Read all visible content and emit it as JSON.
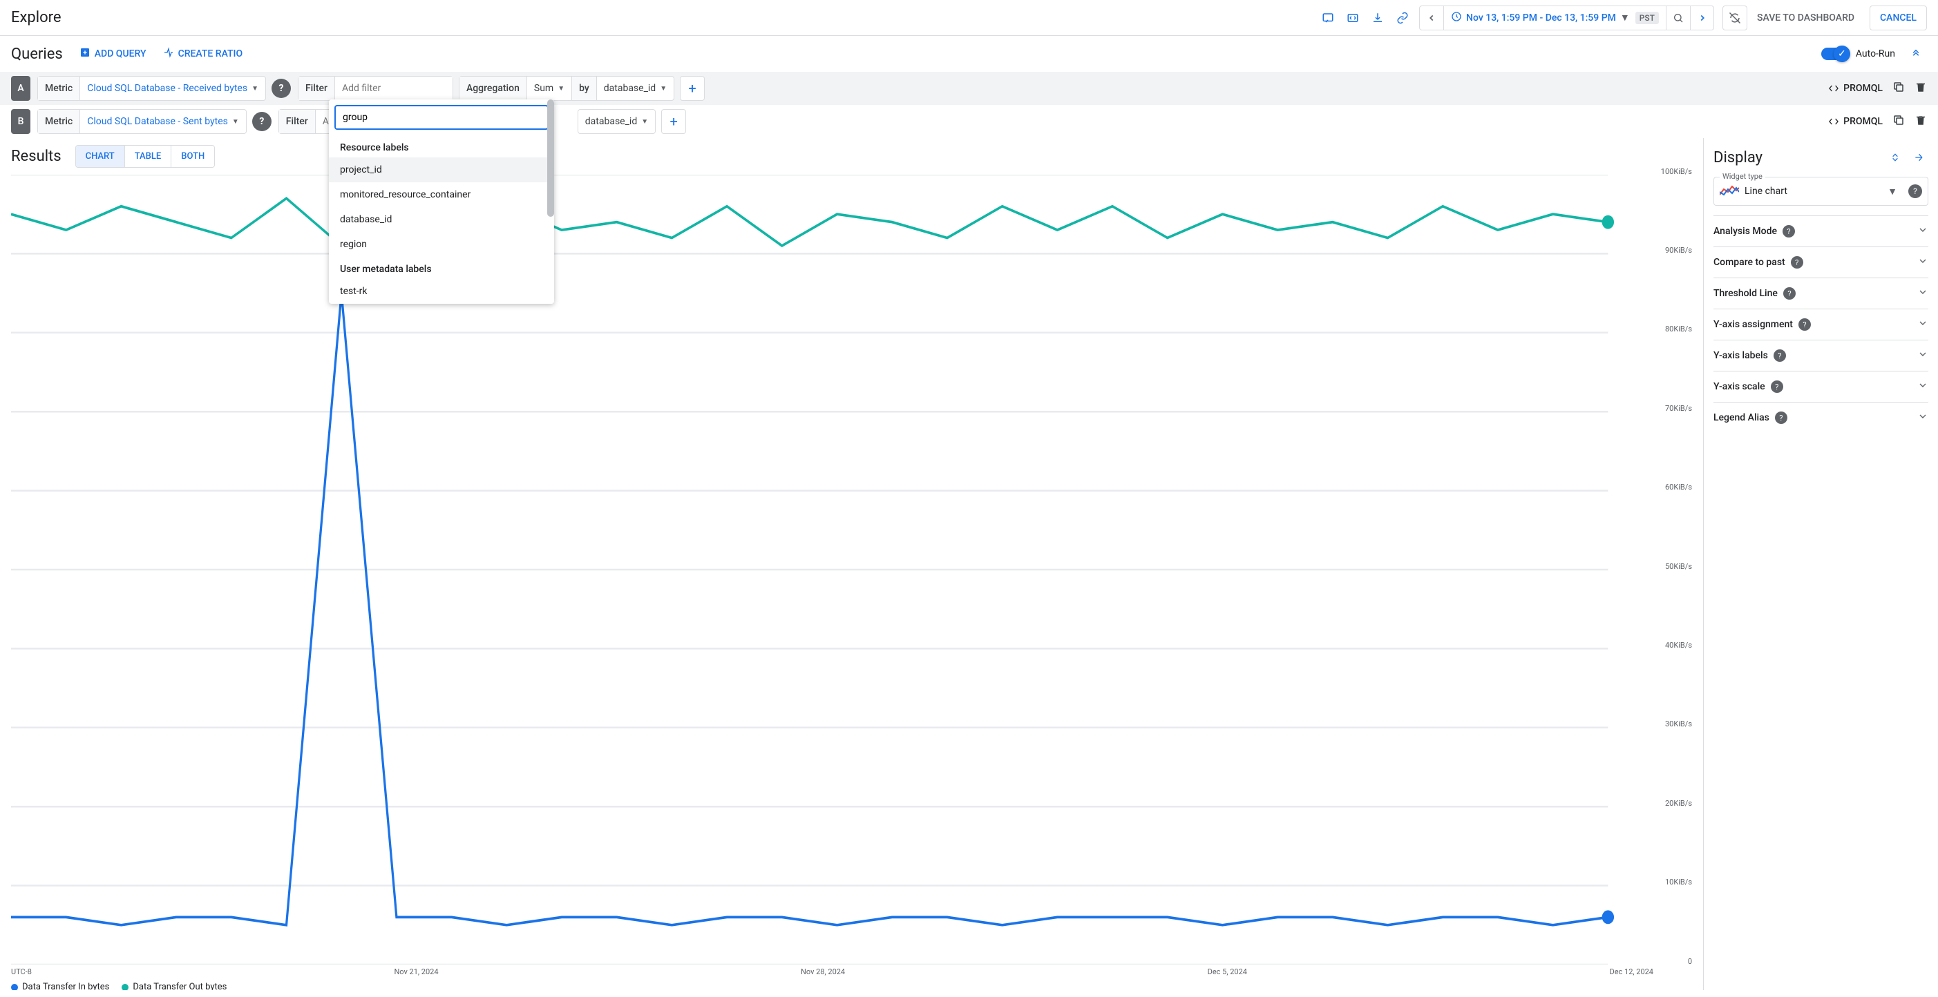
{
  "header": {
    "title": "Explore",
    "timerange": "Nov 13, 1:59 PM - Dec 13, 1:59 PM",
    "tz": "PST",
    "save": "SAVE TO DASHBOARD",
    "cancel": "CANCEL"
  },
  "queries": {
    "title": "Queries",
    "add": "ADD QUERY",
    "ratio": "CREATE RATIO",
    "autorun": "Auto-Run"
  },
  "rowA": {
    "badge": "A",
    "metric_lbl": "Metric",
    "metric_val": "Cloud SQL Database - Received bytes",
    "filter_lbl": "Filter",
    "filter_ph": "Add filter",
    "agg_lbl": "Aggregation",
    "agg_val": "Sum",
    "by": "by",
    "by_val": "database_id",
    "promql": "PROMQL"
  },
  "rowB": {
    "badge": "B",
    "metric_lbl": "Metric",
    "metric_val": "Cloud SQL Database - Sent bytes",
    "filter_lbl": "Filter",
    "filter_ph": "Add",
    "by_val": "database_id",
    "promql": "PROMQL"
  },
  "dropdown": {
    "search": "group",
    "sec1": "Resource labels",
    "opts1": [
      "project_id",
      "monitored_resource_container",
      "database_id",
      "region"
    ],
    "sec2": "User metadata labels",
    "opts2": [
      "test-rk"
    ]
  },
  "results": {
    "title": "Results",
    "tabs": [
      "CHART",
      "TABLE",
      "BOTH"
    ]
  },
  "chart_data": {
    "type": "line",
    "ylim": [
      0,
      100
    ],
    "ylabel": "KiB/s",
    "ytick_labels": [
      "100KiB/s",
      "90KiB/s",
      "80KiB/s",
      "70KiB/s",
      "60KiB/s",
      "50KiB/s",
      "40KiB/s",
      "30KiB/s",
      "20KiB/s",
      "10KiB/s",
      "0"
    ],
    "xtick_labels": [
      "UTC-8",
      "Nov 21, 2024",
      "Nov 28, 2024",
      "Dec 5, 2024",
      "Dec 12, 2024"
    ],
    "series": [
      {
        "name": "Data Transfer In bytes",
        "color": "#1a73e8",
        "values": [
          6,
          6,
          5,
          6,
          6,
          5,
          85,
          6,
          6,
          5,
          6,
          6,
          5,
          6,
          6,
          5,
          6,
          6,
          5,
          6,
          6,
          6,
          5,
          6,
          6,
          5,
          6,
          6,
          5,
          6
        ]
      },
      {
        "name": "Data Transfer Out bytes",
        "color": "#12b5a5",
        "values": [
          95,
          93,
          96,
          94,
          92,
          97,
          91,
          95,
          90,
          96,
          93,
          94,
          92,
          96,
          91,
          95,
          94,
          92,
          96,
          93,
          96,
          92,
          95,
          93,
          94,
          92,
          96,
          93,
          95,
          94
        ]
      }
    ]
  },
  "display": {
    "title": "Display",
    "widget_lbl": "Widget type",
    "widget_val": "Line chart",
    "rows": [
      "Analysis Mode",
      "Compare to past",
      "Threshold Line",
      "Y-axis assignment",
      "Y-axis labels",
      "Y-axis scale",
      "Legend Alias"
    ]
  }
}
